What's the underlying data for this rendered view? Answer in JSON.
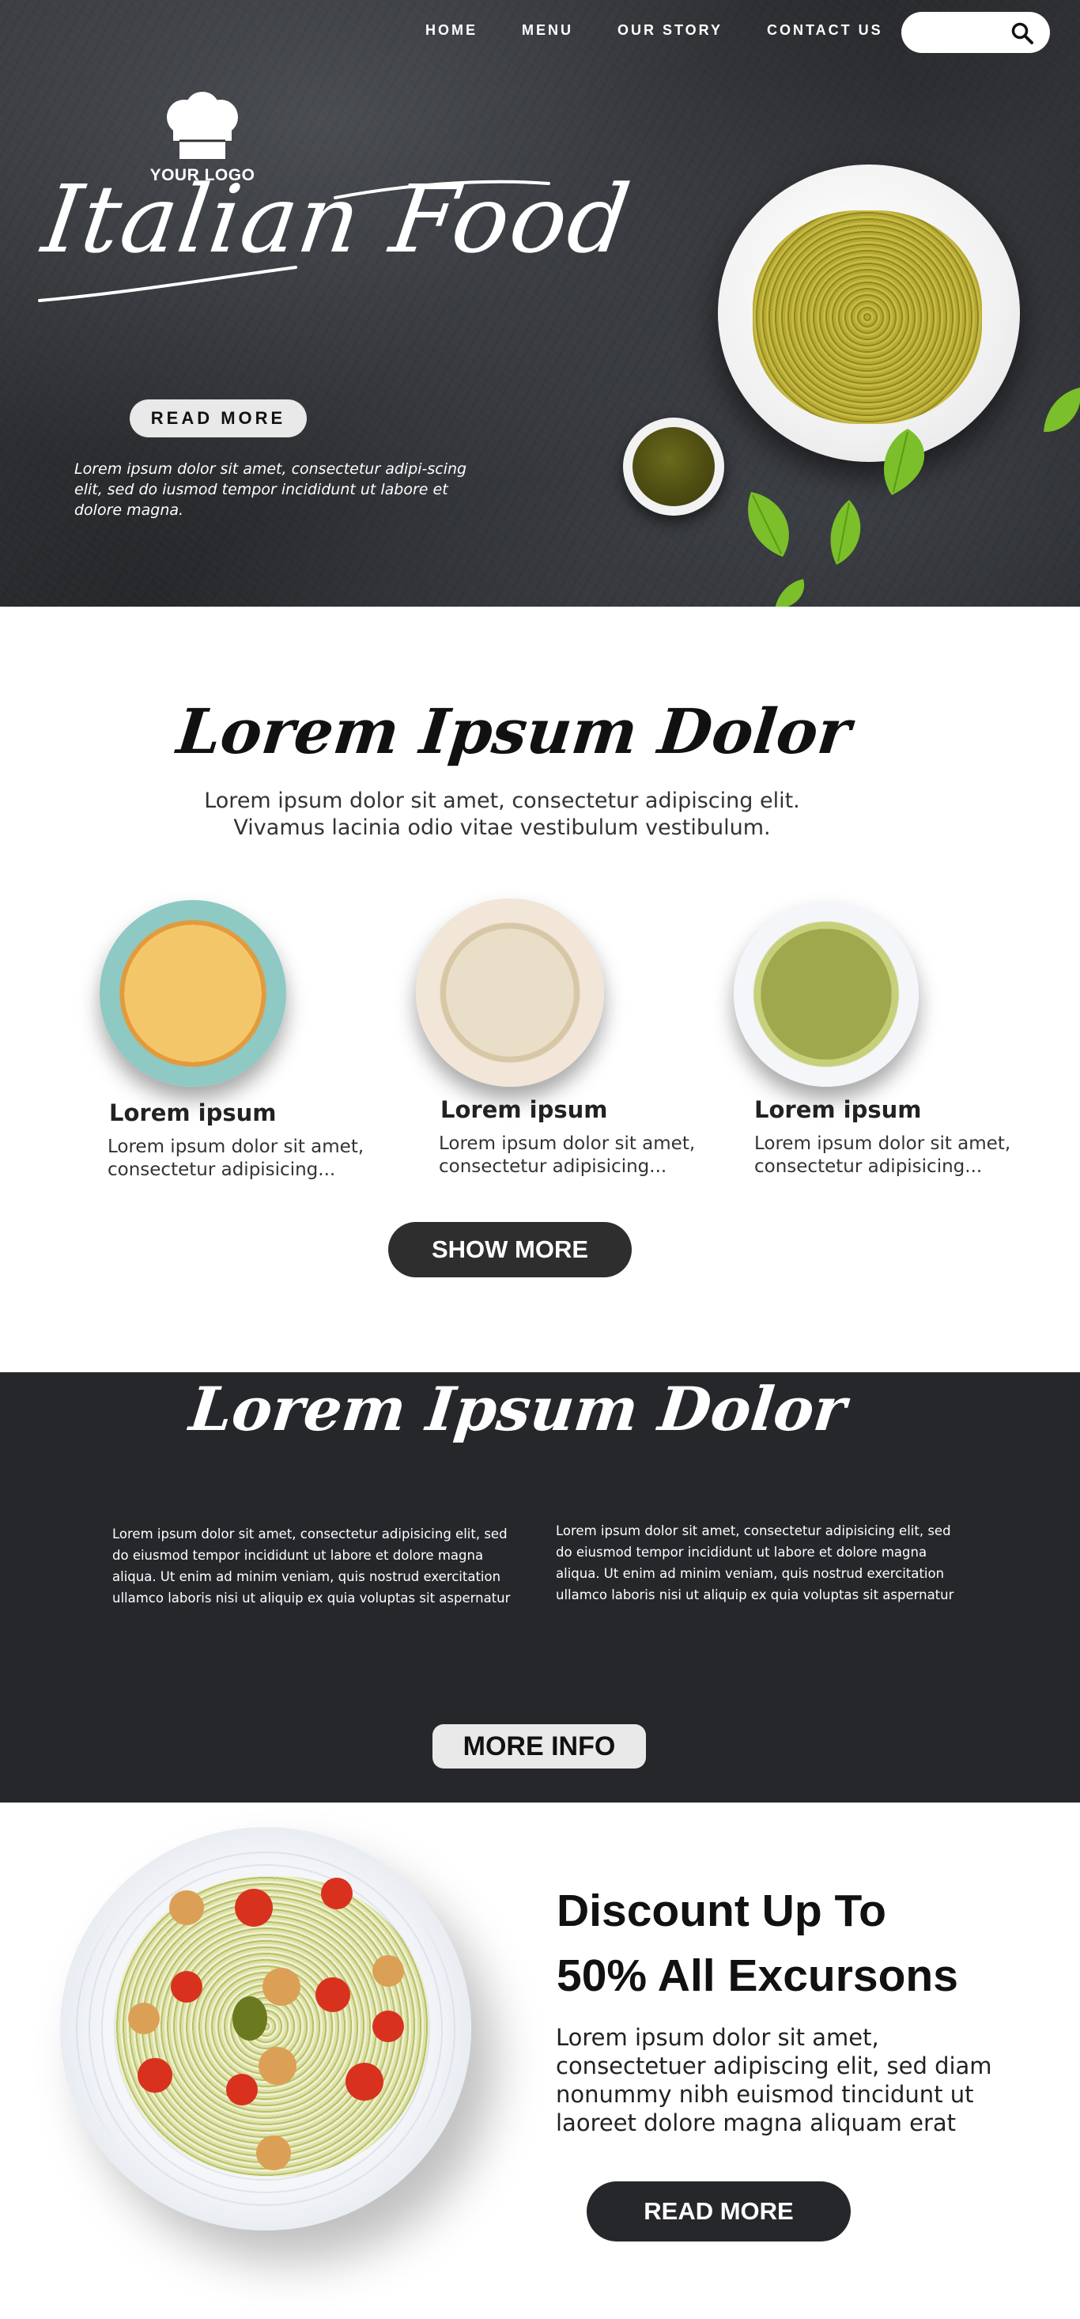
{
  "nav": {
    "items": [
      "HOME",
      "MENU",
      "OUR STORY",
      "CONTACT US"
    ],
    "search": {
      "placeholder": "",
      "icon": "search-icon"
    }
  },
  "hero": {
    "logo_text": "YOUR LOGO",
    "logo_icon": "chef-hat-icon",
    "title": "Italian Food",
    "read_more": "READ MORE",
    "description": "Lorem ipsum dolor sit amet, consectetur adipi-scing elit, sed do iusmod tempor incididunt ut labore et dolore magna."
  },
  "intro": {
    "title": "Lorem Ipsum Dolor",
    "subtitle_line1": "Lorem ipsum dolor sit amet, consectetur adipiscing elit.",
    "subtitle_line2": "Vivamus lacinia odio vitae vestibulum vestibulum."
  },
  "dishes": [
    {
      "title": "Lorem ipsum",
      "desc_line1": "Lorem ipsum dolor sit amet,",
      "desc_line2": "consectetur  adipisicing..."
    },
    {
      "title": "Lorem ipsum",
      "desc_line1": "Lorem ipsum dolor sit amet,",
      "desc_line2": "consectetur  adipisicing..."
    },
    {
      "title": "Lorem ipsum",
      "desc_line1": "Lorem ipsum dolor sit amet,",
      "desc_line2": "consectetur  adipisicing..."
    }
  ],
  "show_more": "SHOW MORE",
  "dark_section": {
    "title": "Lorem Ipsum Dolor",
    "col_left": "Lorem ipsum dolor sit amet, consectetur adipisicing elit, sed do eiusmod tempor incididunt ut labore et dolore magna aliqua. Ut enim ad minim veniam, quis nostrud exercitation ullamco laboris nisi ut aliquip ex quia voluptas sit aspernatur",
    "col_right": "Lorem ipsum dolor sit amet, consectetur adipisicing elit, sed do eiusmod tempor incididunt ut labore et dolore magna aliqua. Ut enim ad minim veniam, quis nostrud exercitation ullamco laboris nisi ut aliquip ex quia voluptas sit aspernatur",
    "more_info": "MORE INFO"
  },
  "promo": {
    "title_line1": "Discount Up To",
    "title_line2": "50% All Excursons",
    "description": "Lorem ipsum dolor sit amet, consectetuer adipiscing elit, sed diam nonummy nibh euismod tincidunt ut laoreet dolore magna aliquam erat",
    "read_more": "READ MORE"
  },
  "colors": {
    "dark_bg": "#25272b",
    "button_light": "#e9e9e9",
    "button_dark": "#2e2e2e",
    "pesto_green": "#7bbf2a"
  }
}
